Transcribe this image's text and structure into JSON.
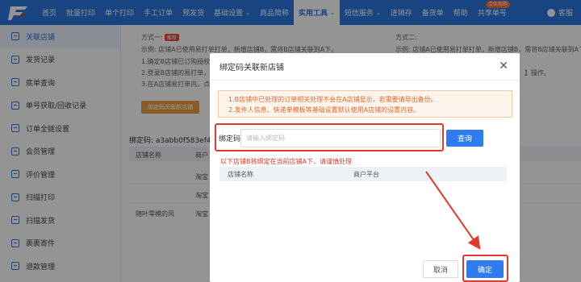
{
  "nav": {
    "items": [
      "首页",
      "批量打印",
      "单个打印",
      "手工订单",
      "预发货",
      "基础设置",
      "商品简称",
      "实用工具",
      "短信服务",
      "进销存",
      "备货单",
      "帮助",
      "共享单号"
    ],
    "dropdown_caret": "⌄",
    "hot_badge": "合伙商购",
    "user": "客服"
  },
  "sidebar": {
    "items": [
      "关联店铺",
      "发货记录",
      "底单查询",
      "单号获取/回收记录",
      "订单全链设置",
      "会员管理",
      "评价管理",
      "扫描打印",
      "扫描发货",
      "裹裹寄件",
      "退款管理"
    ]
  },
  "background": {
    "method1_title": "方式一:",
    "method1_tag": "推荐",
    "method1_desc": "示例: 店铺A已使用易打单打单，新增店铺B，需将B店铺关联到A下。",
    "step1": "1.确定B店铺已订购授权使",
    "step2": "2.登录B店铺的易打单，复",
    "step3": "3.在A店铺易打单内，点击",
    "bind_btn": "绑定码关联新店铺",
    "method2_title": "方式二:",
    "method2_desc": "示例: 店铺A已使用易打单打单，新增店铺B，需将B店铺关联到A下。",
    "method2_tail": "】操作。",
    "bind_code_label": "绑定码:",
    "bind_code_value": "a3abb0f583ef4",
    "col_store": "店铺名称",
    "col_merchant": "商户",
    "row1_platform": "淘宝",
    "row2_platform": "淘宝",
    "row3_store": "随叶零模的风",
    "row3_platform": "淘宝"
  },
  "modal": {
    "title": "绑定码关联新店铺",
    "close_glyph": "✕",
    "notice_line1": "1.B店铺中已处理的订单相关处理不会在A店铺显示，若需要请导出备份。",
    "notice_line2": "2.发件人信息、快递单模板等基础设置默认使用A店铺的设置内容。",
    "code_label": "绑定码",
    "code_placeholder": "请输入绑定码",
    "code_value": "",
    "query_btn": "查询",
    "warning": "以下店铺B将绑定在当前店铺A下，请谨慎处理",
    "table_headers": [
      "店铺名称",
      "商户平台"
    ],
    "cancel_btn": "取消",
    "confirm_btn": "确定"
  },
  "colors": {
    "nav_blue": "#2a75e0",
    "primary_button": "#2f7cf0",
    "highlight_red": "#e23a2e",
    "notice_orange": "#e06a2c"
  }
}
